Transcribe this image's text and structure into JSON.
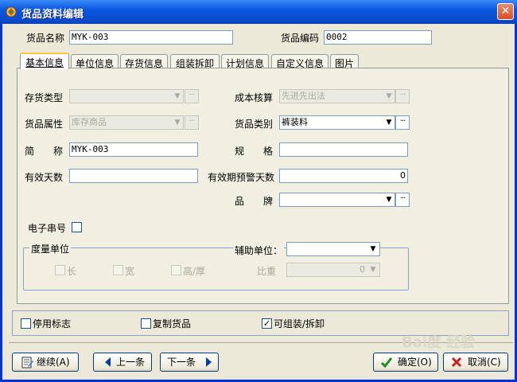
{
  "window": {
    "title": "货品资料编辑",
    "close_label": "✕"
  },
  "header": {
    "product_name_label": "货品名称",
    "product_name_value": "MYK-003",
    "product_code_label": "货品编码",
    "product_code_value": "0002"
  },
  "tabs": [
    {
      "label": "基本信息",
      "active": true
    },
    {
      "label": "单位信息",
      "active": false
    },
    {
      "label": "存货信息",
      "active": false
    },
    {
      "label": "组装拆卸",
      "active": false
    },
    {
      "label": "计划信息",
      "active": false
    },
    {
      "label": "自定义信息",
      "active": false
    },
    {
      "label": "图片",
      "active": false
    }
  ],
  "form": {
    "inventory_type_label": "存货类型",
    "inventory_type_value": "",
    "cost_accounting_label": "成本核算",
    "cost_accounting_value": "先进先出法",
    "product_attribute_label": "货品属性",
    "product_attribute_value": "库存商品",
    "product_category_label": "货品类别",
    "product_category_value": "裤装料",
    "short_name_label": "简　　称",
    "short_name_value": "MYK-003",
    "spec_label": "规　　格",
    "spec_value": "",
    "valid_days_label": "有效天数",
    "valid_days_value": "",
    "warning_days_label": "有效期预警天数",
    "warning_days_value": "0",
    "brand_label": "品　　牌",
    "brand_value": "",
    "serial_label": "电子串号",
    "ellipsis": "···"
  },
  "measure": {
    "group_label": "度量单位",
    "length_label": "长",
    "width_label": "宽",
    "height_label": "高/厚",
    "aux_unit_label": "辅助单位：",
    "aux_unit_value": "",
    "ratio_label": "比重",
    "ratio_value": "0"
  },
  "flags": {
    "disabled_label": "停用标志",
    "copy_label": "复制货品",
    "assemble_label": "可组装/拆卸",
    "assemble_checked": "✓"
  },
  "buttons": {
    "continue_label": "继续(A)",
    "prev_label": "上一条",
    "next_label": "下一条",
    "ok_label": "确定(O)",
    "cancel_label": "取消(C)"
  },
  "watermark": "Bai度 经验"
}
